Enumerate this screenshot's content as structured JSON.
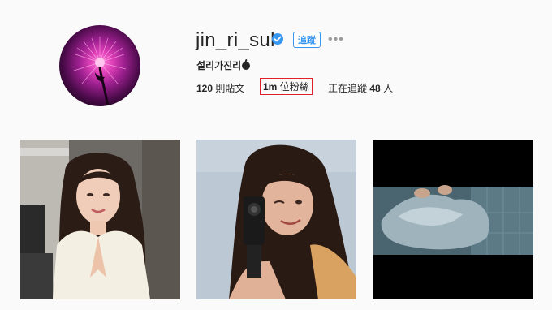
{
  "profile": {
    "username": "jin_ri_sul",
    "full_name": "설리가진리",
    "full_name_icon": "peach-icon",
    "follow_label": "追蹤",
    "more_label": "•••",
    "verified_color": "#3897f0"
  },
  "stats": {
    "posts_count": "120",
    "posts_label": "則貼文",
    "followers_count": "1m",
    "followers_label": "位粉絲",
    "following_label": "正在追蹤",
    "following_count": "48",
    "following_unit": "人"
  },
  "posts": [
    {
      "icon": "photo-portrait-woman"
    },
    {
      "icon": "photo-woman-with-camera"
    },
    {
      "icon": "photo-dark-video-frame"
    }
  ]
}
